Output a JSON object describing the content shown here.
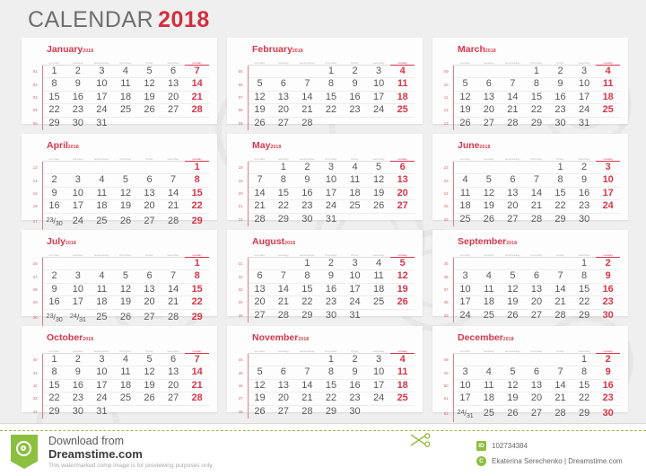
{
  "title": {
    "word": "CALENDAR",
    "year": "2018"
  },
  "weekdays": [
    "monday",
    "tuesday",
    "wednesday",
    "thursday",
    "friday",
    "saturday",
    "sunday"
  ],
  "mini_year": "2018",
  "colors": {
    "accent_red": "#d6374a",
    "title_gray": "#6e6e6e",
    "day_gray": "#58585a",
    "week_number": "#cf5f6d",
    "weekday_label": "#b9b0b2",
    "card_bg": "#fdfdfd",
    "page_bg": "#efefef",
    "footer_green": "#8cbf3f"
  },
  "months": [
    {
      "name": "January",
      "weeks": [
        "01",
        "02",
        "03",
        "04",
        "05"
      ],
      "rows": [
        [
          "1",
          "2",
          "3",
          "4",
          "5",
          "6",
          "7"
        ],
        [
          "8",
          "9",
          "10",
          "11",
          "12",
          "13",
          "14"
        ],
        [
          "15",
          "16",
          "17",
          "18",
          "19",
          "20",
          "21"
        ],
        [
          "22",
          "23",
          "24",
          "25",
          "26",
          "27",
          "28"
        ],
        [
          "29",
          "30",
          "31",
          "",
          "",
          "",
          ""
        ]
      ]
    },
    {
      "name": "February",
      "weeks": [
        "05",
        "06",
        "07",
        "08",
        "09"
      ],
      "rows": [
        [
          "",
          "",
          "",
          "1",
          "2",
          "3",
          "4"
        ],
        [
          "5",
          "6",
          "7",
          "8",
          "9",
          "10",
          "11"
        ],
        [
          "12",
          "13",
          "14",
          "15",
          "16",
          "17",
          "18"
        ],
        [
          "19",
          "20",
          "21",
          "22",
          "23",
          "24",
          "25"
        ],
        [
          "26",
          "27",
          "28",
          "",
          "",
          "",
          ""
        ]
      ]
    },
    {
      "name": "March",
      "weeks": [
        "09",
        "10",
        "11",
        "12",
        "13"
      ],
      "rows": [
        [
          "",
          "",
          "",
          "1",
          "2",
          "3",
          "4"
        ],
        [
          "5",
          "6",
          "7",
          "8",
          "9",
          "10",
          "11"
        ],
        [
          "12",
          "13",
          "14",
          "15",
          "16",
          "17",
          "18"
        ],
        [
          "19",
          "20",
          "21",
          "22",
          "23",
          "24",
          "25"
        ],
        [
          "26",
          "27",
          "28",
          "29",
          "30",
          "31",
          ""
        ]
      ]
    },
    {
      "name": "April",
      "weeks": [
        "13",
        "14",
        "15",
        "16",
        "17"
      ],
      "rows": [
        [
          "",
          "",
          "",
          "",
          "",
          "",
          "1"
        ],
        [
          "2",
          "3",
          "4",
          "5",
          "6",
          "7",
          "8"
        ],
        [
          "9",
          "10",
          "11",
          "12",
          "13",
          "14",
          "15"
        ],
        [
          "16",
          "17",
          "18",
          "19",
          "20",
          "21",
          "22"
        ],
        [
          "23/30",
          "24",
          "25",
          "26",
          "27",
          "28",
          "29"
        ]
      ]
    },
    {
      "name": "May",
      "weeks": [
        "18",
        "19",
        "20",
        "21",
        "22"
      ],
      "rows": [
        [
          "",
          "1",
          "2",
          "3",
          "4",
          "5",
          "6"
        ],
        [
          "7",
          "8",
          "9",
          "10",
          "11",
          "12",
          "13"
        ],
        [
          "14",
          "15",
          "16",
          "17",
          "18",
          "19",
          "20"
        ],
        [
          "21",
          "22",
          "23",
          "24",
          "25",
          "26",
          "27"
        ],
        [
          "28",
          "29",
          "30",
          "31",
          "",
          "",
          ""
        ]
      ]
    },
    {
      "name": "June",
      "weeks": [
        "22",
        "23",
        "24",
        "25",
        "26"
      ],
      "rows": [
        [
          "",
          "",
          "",
          "",
          "1",
          "2",
          "3"
        ],
        [
          "4",
          "5",
          "6",
          "7",
          "8",
          "9",
          "10"
        ],
        [
          "11",
          "12",
          "13",
          "14",
          "15",
          "16",
          "17"
        ],
        [
          "18",
          "19",
          "20",
          "21",
          "22",
          "23",
          "24"
        ],
        [
          "25",
          "26",
          "27",
          "28",
          "29",
          "30",
          ""
        ]
      ]
    },
    {
      "name": "July",
      "weeks": [
        "26",
        "27",
        "28",
        "29",
        "30"
      ],
      "rows": [
        [
          "",
          "",
          "",
          "",
          "",
          "",
          "1"
        ],
        [
          "2",
          "3",
          "4",
          "5",
          "6",
          "7",
          "8"
        ],
        [
          "9",
          "10",
          "11",
          "12",
          "13",
          "14",
          "15"
        ],
        [
          "16",
          "17",
          "18",
          "19",
          "20",
          "21",
          "22"
        ],
        [
          "23/30",
          "24/31",
          "25",
          "26",
          "27",
          "28",
          "29"
        ]
      ]
    },
    {
      "name": "August",
      "weeks": [
        "31",
        "32",
        "33",
        "34",
        "35"
      ],
      "rows": [
        [
          "",
          "",
          "1",
          "2",
          "3",
          "4",
          "5"
        ],
        [
          "6",
          "7",
          "8",
          "9",
          "10",
          "11",
          "12"
        ],
        [
          "13",
          "14",
          "15",
          "16",
          "17",
          "18",
          "19"
        ],
        [
          "20",
          "21",
          "22",
          "23",
          "24",
          "25",
          "26"
        ],
        [
          "27",
          "28",
          "29",
          "30",
          "31",
          "",
          ""
        ]
      ]
    },
    {
      "name": "September",
      "weeks": [
        "35",
        "36",
        "37",
        "38",
        "39"
      ],
      "rows": [
        [
          "",
          "",
          "",
          "",
          "",
          "1",
          "2"
        ],
        [
          "3",
          "4",
          "5",
          "6",
          "7",
          "8",
          "9"
        ],
        [
          "10",
          "11",
          "12",
          "13",
          "14",
          "15",
          "16"
        ],
        [
          "17",
          "18",
          "19",
          "20",
          "21",
          "22",
          "23"
        ],
        [
          "24",
          "25",
          "26",
          "27",
          "28",
          "29",
          "30"
        ]
      ]
    },
    {
      "name": "October",
      "weeks": [
        "40",
        "41",
        "42",
        "43",
        "44"
      ],
      "rows": [
        [
          "1",
          "2",
          "3",
          "4",
          "5",
          "6",
          "7"
        ],
        [
          "8",
          "9",
          "10",
          "11",
          "12",
          "13",
          "14"
        ],
        [
          "15",
          "16",
          "17",
          "18",
          "19",
          "20",
          "21"
        ],
        [
          "22",
          "23",
          "24",
          "25",
          "26",
          "27",
          "28"
        ],
        [
          "29",
          "30",
          "31",
          "",
          "",
          "",
          ""
        ]
      ]
    },
    {
      "name": "November",
      "weeks": [
        "44",
        "45",
        "46",
        "47",
        "48"
      ],
      "rows": [
        [
          "",
          "",
          "",
          "1",
          "2",
          "3",
          "4"
        ],
        [
          "5",
          "6",
          "7",
          "8",
          "9",
          "10",
          "11"
        ],
        [
          "12",
          "13",
          "14",
          "15",
          "16",
          "17",
          "18"
        ],
        [
          "19",
          "20",
          "21",
          "22",
          "23",
          "24",
          "25"
        ],
        [
          "26",
          "27",
          "28",
          "29",
          "30",
          "",
          ""
        ]
      ]
    },
    {
      "name": "December",
      "weeks": [
        "48",
        "49",
        "50",
        "51",
        "52"
      ],
      "rows": [
        [
          "",
          "",
          "",
          "",
          "",
          "1",
          "2"
        ],
        [
          "3",
          "4",
          "5",
          "6",
          "7",
          "8",
          "9"
        ],
        [
          "10",
          "11",
          "12",
          "13",
          "14",
          "15",
          "16"
        ],
        [
          "17",
          "18",
          "19",
          "20",
          "21",
          "22",
          "23"
        ],
        [
          "24/31",
          "25",
          "26",
          "27",
          "28",
          "29",
          "30"
        ]
      ]
    }
  ],
  "footer": {
    "download_from": "Download from",
    "brand": "Dreamstime.com",
    "note": "This watermarked comp image is for previewing purposes only.",
    "id_badge": "ID",
    "id_value": "102734384",
    "copyright_badge": "C",
    "author": "Ekaterina Serechenko | Dreamstime.com"
  }
}
